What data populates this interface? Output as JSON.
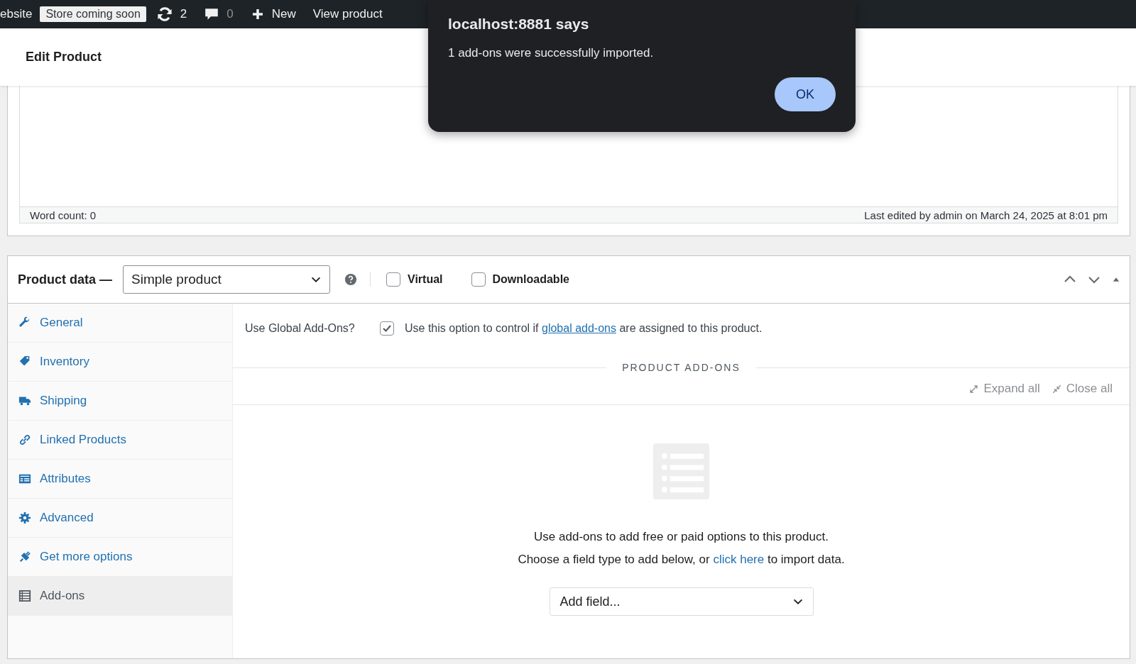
{
  "admin_bar": {
    "site_name": "ebsite",
    "badge": "Store coming soon",
    "updates": "2",
    "comments": "0",
    "new": "New",
    "view": "View product"
  },
  "page_title": "Edit Product",
  "editor": {
    "word_count": "Word count: 0",
    "last_edited": "Last edited by admin on March 24, 2025 at 8:01 pm"
  },
  "product_data": {
    "title": "Product data —",
    "type_select": "Simple product",
    "options": [
      {
        "label": "Virtual",
        "checked": false
      },
      {
        "label": "Downloadable",
        "checked": false
      }
    ],
    "tabs": [
      {
        "label": "General",
        "selected": false
      },
      {
        "label": "Inventory",
        "selected": false
      },
      {
        "label": "Shipping",
        "selected": false
      },
      {
        "label": "Linked Products",
        "selected": false
      },
      {
        "label": "Attributes",
        "selected": false
      },
      {
        "label": "Advanced",
        "selected": false
      },
      {
        "label": "Get more options",
        "selected": false
      },
      {
        "label": "Add-ons",
        "selected": true
      }
    ],
    "global_addons": {
      "label": "Use Global Add-Ons?",
      "checked": true,
      "text_before": "Use this option to control if ",
      "link": "global add-ons",
      "text_after": " are assigned to this product."
    },
    "section_title": "PRODUCT ADD-ONS",
    "expand_all": "Expand all",
    "close_all": "Close all",
    "empty_line1": "Use add-ons to add free or paid options to this product.",
    "empty_line2_before": "Choose a field type to add below, or ",
    "empty_link": "click here",
    "empty_line2_after": " to import data.",
    "add_field": "Add field..."
  },
  "dialog": {
    "title": "localhost:8881 says",
    "message": "1 add-ons were successfully imported.",
    "ok": "OK"
  }
}
